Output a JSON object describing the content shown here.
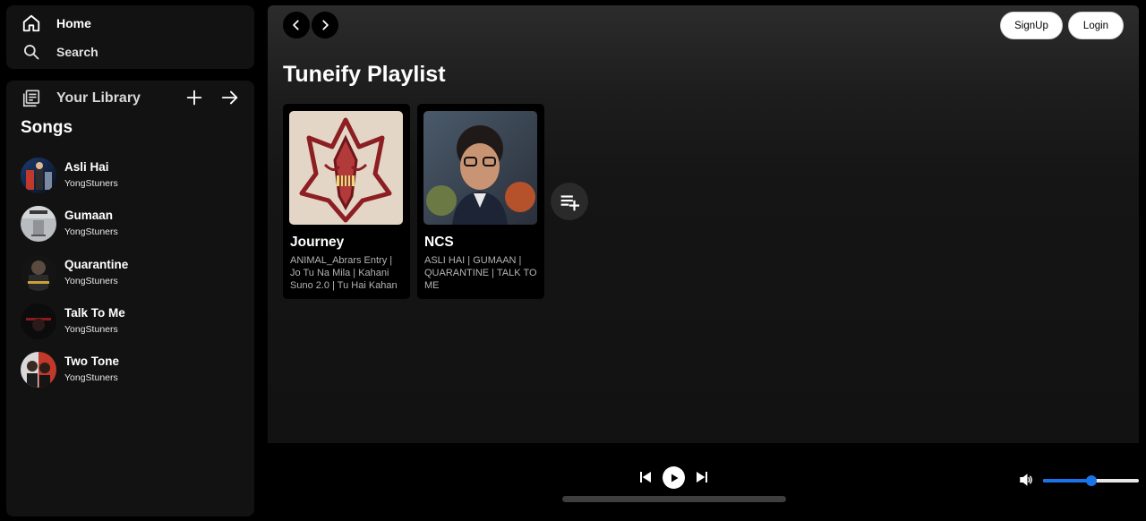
{
  "nav": {
    "home_label": "Home",
    "search_label": "Search"
  },
  "library": {
    "title": "Your Library",
    "songs_heading": "Songs",
    "songs": [
      {
        "title": "Asli Hai",
        "artist": "YongStuners"
      },
      {
        "title": "Gumaan",
        "artist": "YongStuners"
      },
      {
        "title": "Quarantine",
        "artist": "YongStuners"
      },
      {
        "title": "Talk To Me",
        "artist": "YongStuners"
      },
      {
        "title": "Two Tone",
        "artist": "YongStuners"
      }
    ]
  },
  "header": {
    "signup_label": "SignUp",
    "login_label": "Login"
  },
  "main": {
    "title": "Tuneify Playlist",
    "playlists": [
      {
        "title": "Journey",
        "description": "ANIMAL_Abrars Entry | Jo Tu Na Mila | Kahani Suno 2.0 | Tu Hai Kahan"
      },
      {
        "title": "NCS",
        "description": "ASLI HAI | GUMAAN | QUARANTINE | TALK TO ME"
      }
    ]
  },
  "player": {
    "volume_fraction": 0.5
  },
  "colors": {
    "accent": "#1a73e8",
    "panel": "#121212",
    "background": "#000000"
  }
}
